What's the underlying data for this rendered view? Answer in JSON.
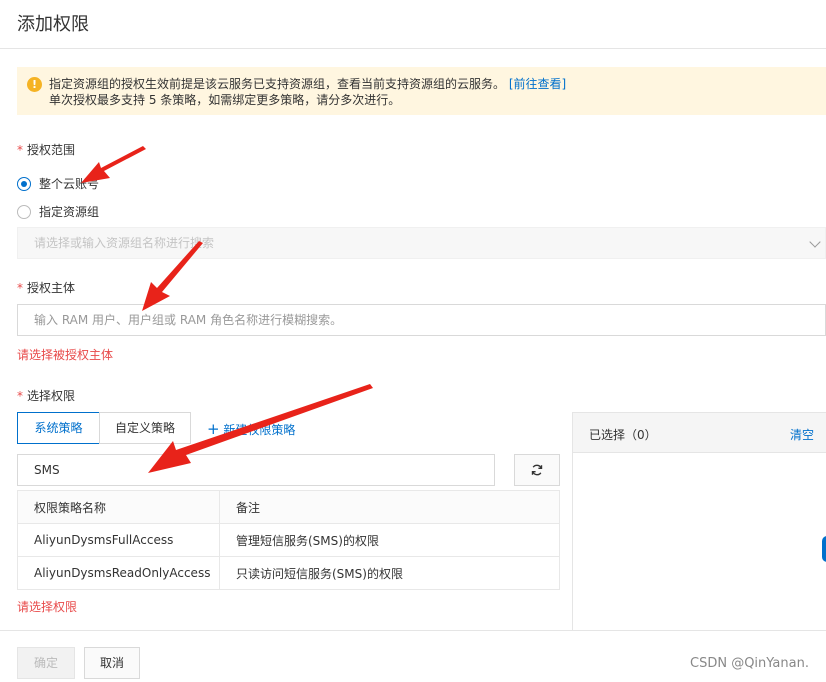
{
  "page": {
    "title": "添加权限"
  },
  "notice": {
    "line1": "指定资源组的授权生效前提是该云服务已支持资源组，查看当前支持资源组的云服务。",
    "link": "[前往查看]",
    "line2": "单次授权最多支持 5 条策略，如需绑定更多策略，请分多次进行。",
    "icon": "warning-icon",
    "color": "#f5b324"
  },
  "scope": {
    "label": "授权范围",
    "options": [
      {
        "label": "整个云账号",
        "checked": true
      },
      {
        "label": "指定资源组",
        "checked": false
      }
    ],
    "resource_group_placeholder": "请选择或输入资源组名称进行搜索"
  },
  "principal": {
    "label": "授权主体",
    "placeholder": "输入 RAM 用户、用户组或 RAM 角色名称进行模糊搜索。",
    "error": "请选择被授权主体"
  },
  "permissions": {
    "label": "选择权限",
    "tabs": [
      {
        "label": "系统策略",
        "active": true
      },
      {
        "label": "自定义策略",
        "active": false
      }
    ],
    "new_policy": "新建权限策略",
    "search_value": "SMS",
    "table": {
      "headers": [
        "权限策略名称",
        "备注"
      ],
      "rows": [
        [
          "AliyunDysmsFullAccess",
          "管理短信服务(SMS)的权限"
        ],
        [
          "AliyunDysmsReadOnlyAccess",
          "只读访问短信服务(SMS)的权限"
        ]
      ]
    },
    "error": "请选择权限",
    "selected": {
      "label": "已选择（0）",
      "clear": "清空"
    }
  },
  "footer": {
    "ok": "确定",
    "cancel": "取消"
  },
  "watermark": "CSDN @QinYanan.",
  "colors": {
    "accent": "#0070cc",
    "error": "#e84a4a",
    "arrow": "#e8231a"
  }
}
